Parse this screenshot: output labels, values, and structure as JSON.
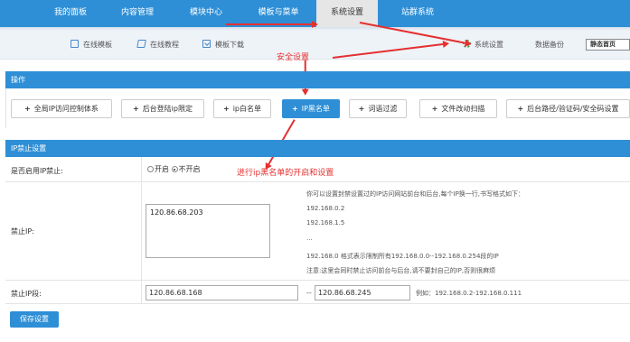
{
  "top_nav": {
    "tabs": [
      "我的面板",
      "内容管理",
      "模块中心",
      "模板与菜单",
      "系统设置",
      "站群系统"
    ],
    "active": "系统设置"
  },
  "sub_nav": {
    "left_items": [
      {
        "label": "在线模板",
        "icon": "monitor-icon"
      },
      {
        "label": "在线教程",
        "icon": "book-icon"
      },
      {
        "label": "模板下载",
        "icon": "download-icon"
      }
    ],
    "right_items": [
      {
        "label": "系统设置",
        "icon": "gear-icon"
      },
      {
        "label": "数据备份"
      }
    ],
    "select_value": "静态首页"
  },
  "annotations": {
    "security": "安全设置",
    "blacklist": "进行ip黑名单的开启和设置"
  },
  "ops_panel": {
    "title": "操作",
    "buttons": [
      "全局IP访问控制体系",
      "后台登陆ip限定",
      "ip白名单",
      "IP黑名单",
      "词语过滤",
      "文件改动扫描",
      "后台路径/验证码/安全码设置"
    ],
    "active_button": "IP黑名单"
  },
  "ipban_panel": {
    "title": "IP禁止设置",
    "enable_label": "是否启用IP禁止:",
    "radio_on": "开启",
    "radio_off": "不开启",
    "selected": "不开启",
    "ban_label": "禁止IP:",
    "ban_value": "120.86.68.203",
    "help": [
      "你可以设置封禁设置过的IP访问网站前台和后台,每个IP换一行,书写格式如下：",
      "192.168.0.2",
      "192.168.1.5",
      "...",
      "192.168.0 格式表示限制所有192.168.0.0--192.168.0.254段的IP",
      "注意:这里会同时禁止访问前台与后台,请不要封自己的IP,否则很麻烦"
    ],
    "range_label": "禁止IP段:",
    "range_from": "120.86.68.168",
    "range_sep": "--",
    "range_to": "120.86.68.245",
    "range_example": "例如：192.168.0.2-192.168.0.111"
  },
  "save_label": "保存设置",
  "colors": {
    "accent": "#2e8fd6",
    "annotation": "#e53030"
  }
}
